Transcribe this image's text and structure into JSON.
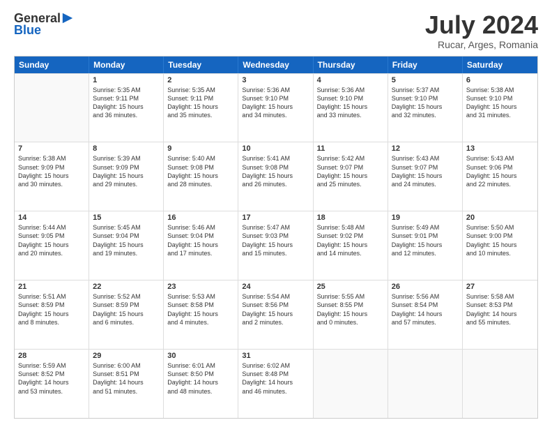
{
  "header": {
    "logo_general": "General",
    "logo_blue": "Blue",
    "title": "July 2024",
    "location": "Rucar, Arges, Romania"
  },
  "days_of_week": [
    "Sunday",
    "Monday",
    "Tuesday",
    "Wednesday",
    "Thursday",
    "Friday",
    "Saturday"
  ],
  "weeks": [
    [
      {
        "day": "",
        "lines": []
      },
      {
        "day": "1",
        "lines": [
          "Sunrise: 5:35 AM",
          "Sunset: 9:11 PM",
          "Daylight: 15 hours",
          "and 36 minutes."
        ]
      },
      {
        "day": "2",
        "lines": [
          "Sunrise: 5:35 AM",
          "Sunset: 9:11 PM",
          "Daylight: 15 hours",
          "and 35 minutes."
        ]
      },
      {
        "day": "3",
        "lines": [
          "Sunrise: 5:36 AM",
          "Sunset: 9:10 PM",
          "Daylight: 15 hours",
          "and 34 minutes."
        ]
      },
      {
        "day": "4",
        "lines": [
          "Sunrise: 5:36 AM",
          "Sunset: 9:10 PM",
          "Daylight: 15 hours",
          "and 33 minutes."
        ]
      },
      {
        "day": "5",
        "lines": [
          "Sunrise: 5:37 AM",
          "Sunset: 9:10 PM",
          "Daylight: 15 hours",
          "and 32 minutes."
        ]
      },
      {
        "day": "6",
        "lines": [
          "Sunrise: 5:38 AM",
          "Sunset: 9:10 PM",
          "Daylight: 15 hours",
          "and 31 minutes."
        ]
      }
    ],
    [
      {
        "day": "7",
        "lines": [
          "Sunrise: 5:38 AM",
          "Sunset: 9:09 PM",
          "Daylight: 15 hours",
          "and 30 minutes."
        ]
      },
      {
        "day": "8",
        "lines": [
          "Sunrise: 5:39 AM",
          "Sunset: 9:09 PM",
          "Daylight: 15 hours",
          "and 29 minutes."
        ]
      },
      {
        "day": "9",
        "lines": [
          "Sunrise: 5:40 AM",
          "Sunset: 9:08 PM",
          "Daylight: 15 hours",
          "and 28 minutes."
        ]
      },
      {
        "day": "10",
        "lines": [
          "Sunrise: 5:41 AM",
          "Sunset: 9:08 PM",
          "Daylight: 15 hours",
          "and 26 minutes."
        ]
      },
      {
        "day": "11",
        "lines": [
          "Sunrise: 5:42 AM",
          "Sunset: 9:07 PM",
          "Daylight: 15 hours",
          "and 25 minutes."
        ]
      },
      {
        "day": "12",
        "lines": [
          "Sunrise: 5:43 AM",
          "Sunset: 9:07 PM",
          "Daylight: 15 hours",
          "and 24 minutes."
        ]
      },
      {
        "day": "13",
        "lines": [
          "Sunrise: 5:43 AM",
          "Sunset: 9:06 PM",
          "Daylight: 15 hours",
          "and 22 minutes."
        ]
      }
    ],
    [
      {
        "day": "14",
        "lines": [
          "Sunrise: 5:44 AM",
          "Sunset: 9:05 PM",
          "Daylight: 15 hours",
          "and 20 minutes."
        ]
      },
      {
        "day": "15",
        "lines": [
          "Sunrise: 5:45 AM",
          "Sunset: 9:04 PM",
          "Daylight: 15 hours",
          "and 19 minutes."
        ]
      },
      {
        "day": "16",
        "lines": [
          "Sunrise: 5:46 AM",
          "Sunset: 9:04 PM",
          "Daylight: 15 hours",
          "and 17 minutes."
        ]
      },
      {
        "day": "17",
        "lines": [
          "Sunrise: 5:47 AM",
          "Sunset: 9:03 PM",
          "Daylight: 15 hours",
          "and 15 minutes."
        ]
      },
      {
        "day": "18",
        "lines": [
          "Sunrise: 5:48 AM",
          "Sunset: 9:02 PM",
          "Daylight: 15 hours",
          "and 14 minutes."
        ]
      },
      {
        "day": "19",
        "lines": [
          "Sunrise: 5:49 AM",
          "Sunset: 9:01 PM",
          "Daylight: 15 hours",
          "and 12 minutes."
        ]
      },
      {
        "day": "20",
        "lines": [
          "Sunrise: 5:50 AM",
          "Sunset: 9:00 PM",
          "Daylight: 15 hours",
          "and 10 minutes."
        ]
      }
    ],
    [
      {
        "day": "21",
        "lines": [
          "Sunrise: 5:51 AM",
          "Sunset: 8:59 PM",
          "Daylight: 15 hours",
          "and 8 minutes."
        ]
      },
      {
        "day": "22",
        "lines": [
          "Sunrise: 5:52 AM",
          "Sunset: 8:59 PM",
          "Daylight: 15 hours",
          "and 6 minutes."
        ]
      },
      {
        "day": "23",
        "lines": [
          "Sunrise: 5:53 AM",
          "Sunset: 8:58 PM",
          "Daylight: 15 hours",
          "and 4 minutes."
        ]
      },
      {
        "day": "24",
        "lines": [
          "Sunrise: 5:54 AM",
          "Sunset: 8:56 PM",
          "Daylight: 15 hours",
          "and 2 minutes."
        ]
      },
      {
        "day": "25",
        "lines": [
          "Sunrise: 5:55 AM",
          "Sunset: 8:55 PM",
          "Daylight: 15 hours",
          "and 0 minutes."
        ]
      },
      {
        "day": "26",
        "lines": [
          "Sunrise: 5:56 AM",
          "Sunset: 8:54 PM",
          "Daylight: 14 hours",
          "and 57 minutes."
        ]
      },
      {
        "day": "27",
        "lines": [
          "Sunrise: 5:58 AM",
          "Sunset: 8:53 PM",
          "Daylight: 14 hours",
          "and 55 minutes."
        ]
      }
    ],
    [
      {
        "day": "28",
        "lines": [
          "Sunrise: 5:59 AM",
          "Sunset: 8:52 PM",
          "Daylight: 14 hours",
          "and 53 minutes."
        ]
      },
      {
        "day": "29",
        "lines": [
          "Sunrise: 6:00 AM",
          "Sunset: 8:51 PM",
          "Daylight: 14 hours",
          "and 51 minutes."
        ]
      },
      {
        "day": "30",
        "lines": [
          "Sunrise: 6:01 AM",
          "Sunset: 8:50 PM",
          "Daylight: 14 hours",
          "and 48 minutes."
        ]
      },
      {
        "day": "31",
        "lines": [
          "Sunrise: 6:02 AM",
          "Sunset: 8:48 PM",
          "Daylight: 14 hours",
          "and 46 minutes."
        ]
      },
      {
        "day": "",
        "lines": []
      },
      {
        "day": "",
        "lines": []
      },
      {
        "day": "",
        "lines": []
      }
    ]
  ]
}
